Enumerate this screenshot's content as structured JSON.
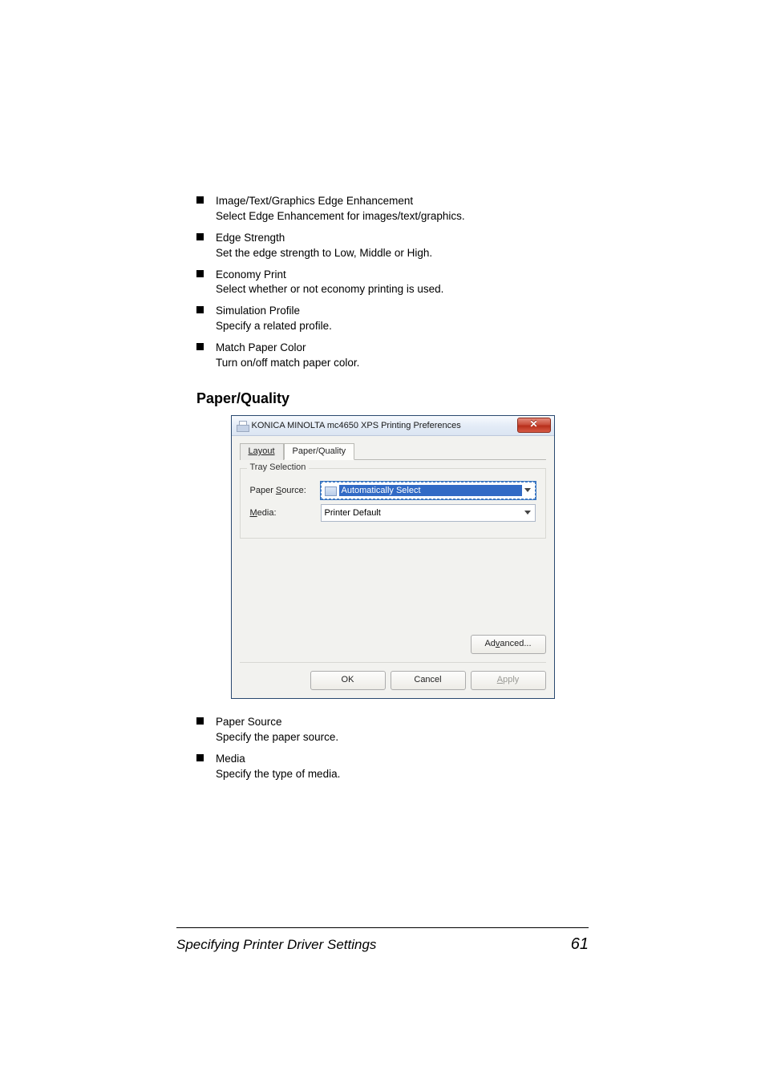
{
  "bullets_top": [
    {
      "title": "Image/Text/Graphics Edge Enhancement",
      "desc": "Select Edge Enhancement for images/text/graphics."
    },
    {
      "title": "Edge Strength",
      "desc": "Set the edge strength to Low, Middle or High."
    },
    {
      "title": "Economy Print",
      "desc": "Select whether or not economy printing is used."
    },
    {
      "title": "Simulation Profile",
      "desc": "Specify a related profile."
    },
    {
      "title": "Match Paper Color",
      "desc": "Turn on/off match paper color."
    }
  ],
  "section_heading": "Paper/Quality",
  "dialog": {
    "title": "KONICA MINOLTA mc4650 XPS Printing Preferences",
    "close": "✕",
    "tabs": {
      "layout": "Layout",
      "paper_quality": "Paper/Quality"
    },
    "group_legend": "Tray Selection",
    "paper_source": {
      "label_pre": "Paper ",
      "label_u": "S",
      "label_post": "ource:",
      "value": "Automatically Select"
    },
    "media": {
      "label_u": "M",
      "label_post": "edia:",
      "value": "Printer Default"
    },
    "advanced": {
      "pre": "Ad",
      "u": "v",
      "post": "anced..."
    },
    "ok": "OK",
    "cancel": "Cancel",
    "apply": {
      "u": "A",
      "post": "pply"
    }
  },
  "bullets_bottom": [
    {
      "title": "Paper Source",
      "desc": "Specify the paper source."
    },
    {
      "title": "Media",
      "desc": "Specify the type of media."
    }
  ],
  "footer": {
    "title": "Specifying Printer Driver Settings",
    "page": "61"
  }
}
